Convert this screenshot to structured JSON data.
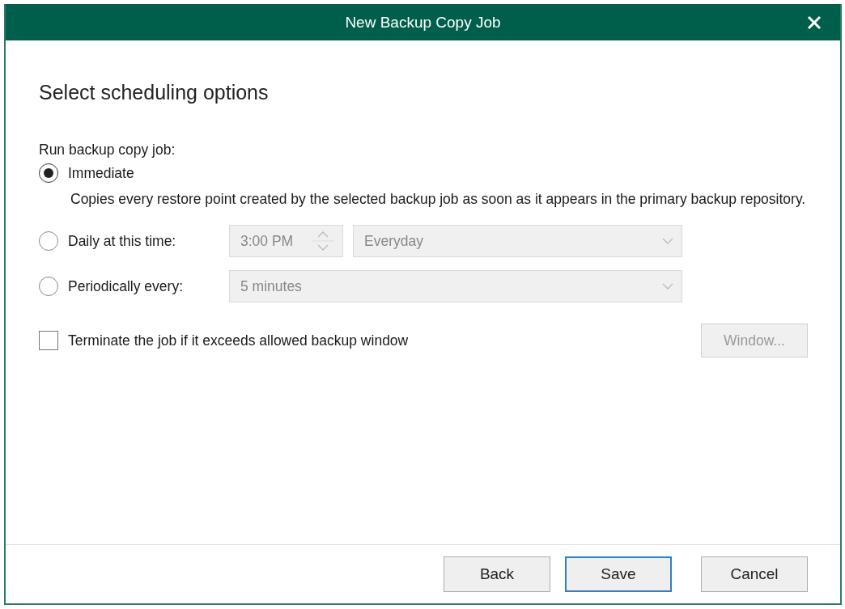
{
  "window": {
    "title": "New Backup Copy Job"
  },
  "heading": "Select scheduling options",
  "run_label": "Run backup copy job:",
  "options": [
    {
      "kind": "plain",
      "label": "Immediate",
      "selected": true,
      "description": "Copies every restore point created by the selected backup job as soon as it appears in the primary backup repository."
    },
    {
      "kind": "time",
      "label": "Daily at this time:",
      "selected": false,
      "time": "3:00 PM",
      "days": "Everyday",
      "disabled": true
    },
    {
      "kind": "interval",
      "label": "Periodically every:",
      "selected": false,
      "interval": "5 minutes",
      "disabled": true
    }
  ],
  "terminate": {
    "label": "Terminate the job if it exceeds allowed backup window",
    "checked": false,
    "button": "Window...",
    "button_disabled": true
  },
  "buttons": [
    {
      "label": "Back",
      "default": false
    },
    {
      "label": "Save",
      "default": true
    },
    {
      "label": "Cancel",
      "default": false
    }
  ]
}
